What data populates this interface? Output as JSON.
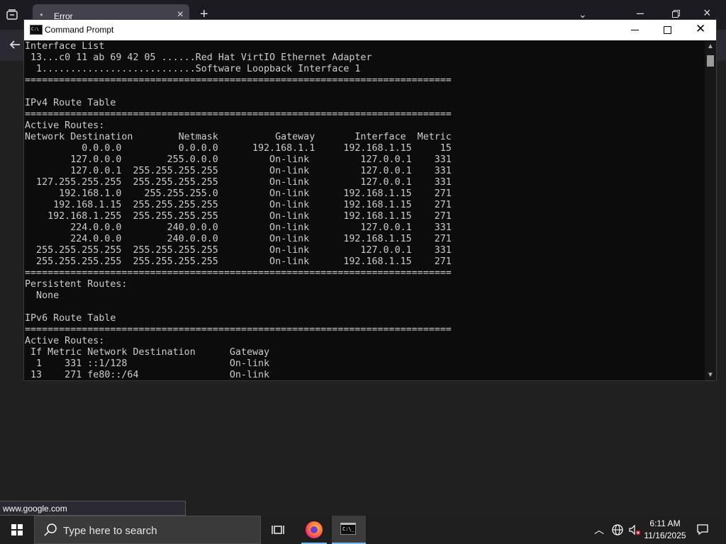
{
  "browser": {
    "tab_title": "Error",
    "new_tab_symbol": "+",
    "status_url": "www.google.com"
  },
  "cmd": {
    "title": "Command Prompt",
    "output": "Interface List\n 13...c0 11 ab 69 42 05 ......Red Hat VirtIO Ethernet Adapter\n  1...........................Software Loopback Interface 1\n===========================================================================\n\nIPv4 Route Table\n===========================================================================\nActive Routes:\nNetwork Destination        Netmask          Gateway       Interface  Metric\n          0.0.0.0          0.0.0.0      192.168.1.1     192.168.1.15     15\n        127.0.0.0        255.0.0.0         On-link         127.0.0.1    331\n        127.0.0.1  255.255.255.255         On-link         127.0.0.1    331\n  127.255.255.255  255.255.255.255         On-link         127.0.0.1    331\n      192.168.1.0    255.255.255.0         On-link      192.168.1.15    271\n     192.168.1.15  255.255.255.255         On-link      192.168.1.15    271\n    192.168.1.255  255.255.255.255         On-link      192.168.1.15    271\n        224.0.0.0        240.0.0.0         On-link         127.0.0.1    331\n        224.0.0.0        240.0.0.0         On-link      192.168.1.15    271\n  255.255.255.255  255.255.255.255         On-link         127.0.0.1    331\n  255.255.255.255  255.255.255.255         On-link      192.168.1.15    271\n===========================================================================\nPersistent Routes:\n  None\n\nIPv6 Route Table\n===========================================================================\nActive Routes:\n If Metric Network Destination      Gateway\n  1    331 ::1/128                  On-link\n 13    271 fe80::/64                On-link"
  },
  "taskbar": {
    "search_placeholder": "Type here to search",
    "time": "6:11 AM",
    "date": "11/16/2025",
    "apps": [
      "task-view",
      "firefox",
      "command-prompt"
    ]
  },
  "colors": {
    "console_bg": "#0c0c0c",
    "console_text": "#cccccc",
    "taskbar_bg": "#1f1f1f",
    "accent": "#76b9ed"
  }
}
